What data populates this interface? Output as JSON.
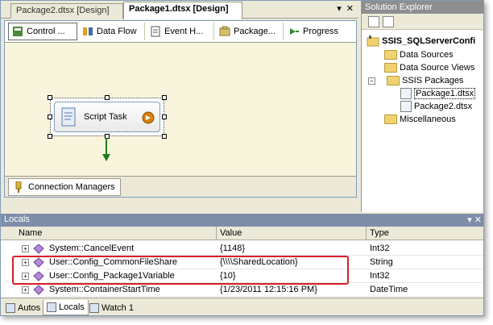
{
  "doc_tabs": {
    "inactive": "Package2.dtsx [Design]",
    "active": "Package1.dtsx [Design]",
    "controls": [
      "▾",
      "✕"
    ]
  },
  "designer_tabs": [
    {
      "label": "Control ...",
      "icon": "control-flow-icon"
    },
    {
      "label": "Data Flow",
      "icon": "data-flow-icon"
    },
    {
      "label": "Event H...",
      "icon": "event-handlers-icon"
    },
    {
      "label": "Package...",
      "icon": "package-explorer-icon"
    },
    {
      "label": "Progress",
      "icon": "progress-icon"
    }
  ],
  "canvas": {
    "task_label": "Script Task"
  },
  "connection_managers": {
    "label": "Connection Managers"
  },
  "solution_explorer": {
    "title": "Solution Explorer",
    "project": "SSIS_SQLServerConfi",
    "items": [
      {
        "label": "Data Sources",
        "type": "folder"
      },
      {
        "label": "Data Source Views",
        "type": "folder"
      },
      {
        "label": "SSIS Packages",
        "type": "folder"
      },
      {
        "label": "Package1.dtsx",
        "type": "package"
      },
      {
        "label": "Package2.dtsx",
        "type": "package"
      },
      {
        "label": "Miscellaneous",
        "type": "folder"
      }
    ]
  },
  "locals": {
    "title": "Locals",
    "close": "▾ ✕",
    "columns": [
      "Name",
      "Value",
      "Type"
    ],
    "rows": [
      {
        "name": "System::CancelEvent",
        "value": "{1148}",
        "type": "Int32"
      },
      {
        "name": "User::Config_CommonFileShare",
        "value": "{\\\\\\\\SharedLocation}",
        "type": "String"
      },
      {
        "name": "User::Config_Package1Variable",
        "value": "{10}",
        "type": "Int32"
      },
      {
        "name": "System::ContainerStartTime",
        "value": "{1/23/2011 12:15:16 PM}",
        "type": "DateTime"
      }
    ]
  },
  "bottom_tabs": [
    {
      "label": "Autos",
      "icon": "autos-icon"
    },
    {
      "label": "Locals",
      "icon": "locals-icon"
    },
    {
      "label": "Watch 1",
      "icon": "watch-icon"
    }
  ]
}
